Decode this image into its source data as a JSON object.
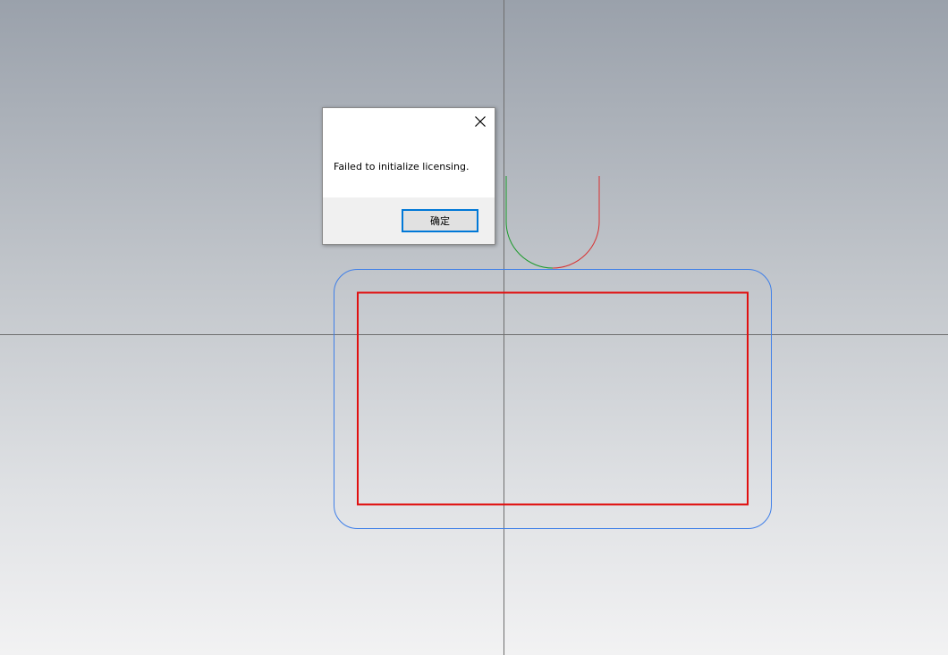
{
  "dialog": {
    "message": "Failed to initialize licensing.",
    "ok_label": "确定",
    "close_icon": "close-icon"
  },
  "canvas": {
    "colors": {
      "axis": "#6e6e6e",
      "outer_profile": "#3f7fe8",
      "inner_rectangle": "#e01010",
      "arc_green": "#1a9a2a",
      "arc_red": "#d83030"
    }
  }
}
